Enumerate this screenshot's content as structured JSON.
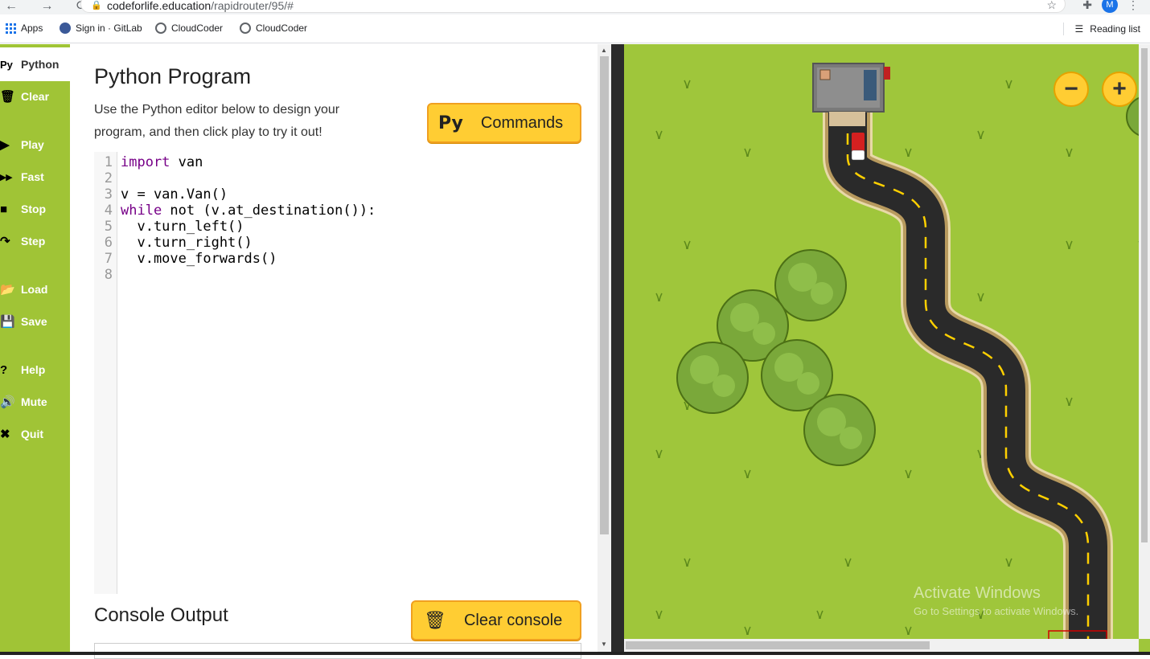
{
  "browser": {
    "url_domain": "codeforlife.education",
    "url_path": "/rapidrouter/95/#",
    "avatar_letter": "M",
    "bookmarks": [
      {
        "label": "Apps",
        "icon": "apps-grid-icon"
      },
      {
        "label": "Sign in · GitLab",
        "icon": "gitlab-icon"
      },
      {
        "label": "CloudCoder",
        "icon": "globe-icon"
      },
      {
        "label": "CloudCoder",
        "icon": "globe-icon"
      }
    ],
    "reading_list": "Reading list"
  },
  "sidebar": {
    "items": [
      {
        "icon": "Py",
        "label": "Python"
      },
      {
        "icon": "🗑",
        "label": "Clear"
      },
      {
        "icon": "▶",
        "label": "Play"
      },
      {
        "icon": "▸▸",
        "label": "Fast"
      },
      {
        "icon": "■",
        "label": "Stop"
      },
      {
        "icon": "↷",
        "label": "Step"
      },
      {
        "icon": "📂",
        "label": "Load"
      },
      {
        "icon": "💾",
        "label": "Save"
      },
      {
        "icon": "?",
        "label": "Help"
      },
      {
        "icon": "🔊",
        "label": "Mute"
      },
      {
        "icon": "✖",
        "label": "Quit"
      }
    ]
  },
  "main": {
    "title": "Python Program",
    "description": "Use the Python editor below to design your program, and then click play to try it out!",
    "commands_icon": "Py",
    "commands_label": "Commands",
    "console_title": "Console Output",
    "clear_console_label": "Clear console"
  },
  "editor": {
    "lines": [
      {
        "n": "1",
        "kw": "import",
        "rest": " van"
      },
      {
        "n": "2",
        "kw": "",
        "rest": ""
      },
      {
        "n": "3",
        "kw": "",
        "rest": "v = van.Van()"
      },
      {
        "n": "4",
        "kw": "while",
        "rest": " not (v.at_destination()):"
      },
      {
        "n": "5",
        "kw": "",
        "rest": "  v.turn_left()"
      },
      {
        "n": "6",
        "kw": "",
        "rest": "  v.turn_right()"
      },
      {
        "n": "7",
        "kw": "",
        "rest": "  v.move_forwards()"
      },
      {
        "n": "8",
        "kw": "",
        "rest": ""
      }
    ]
  },
  "game": {
    "zoom_out": "−",
    "zoom_in": "+",
    "watermark_title": "Activate Windows",
    "watermark_sub": "Go to Settings to activate Windows.",
    "colors": {
      "grass": "#9fc63b",
      "road": "#2a2a2a",
      "curb": "#e8d9a8",
      "lane": "#ffd000",
      "tree": "#7aa83a",
      "van": "#d42020"
    }
  }
}
